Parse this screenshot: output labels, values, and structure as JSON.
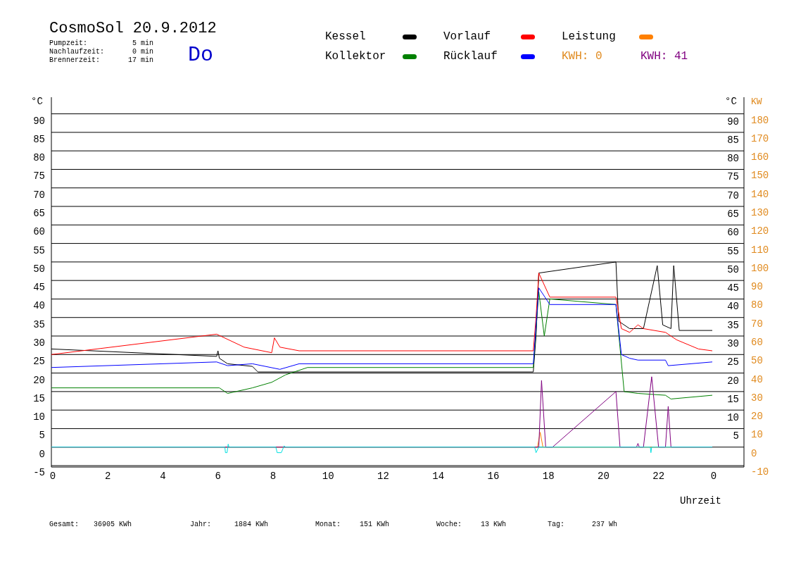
{
  "header": {
    "title": "CosmoSol 20.9.2012",
    "weekday": "Do",
    "times": [
      {
        "label": "Pumpzeit:",
        "value": "5 min"
      },
      {
        "label": "Nachlaufzeit:",
        "value": "0 min"
      },
      {
        "label": "Brennerzeit:",
        "value": "17 min"
      }
    ]
  },
  "totals": [
    {
      "label": "KWH: 0",
      "color": "#e08a1e"
    },
    {
      "label": "KWH: 41",
      "color": "#800080"
    }
  ],
  "chart_data": {
    "type": "line",
    "xlabel": "Uhrzeit",
    "ylabel": "°C",
    "y2label": "KW",
    "grid": true,
    "xlim": [
      0,
      25.15
    ],
    "ylim": [
      -5,
      90
    ],
    "y2lim": [
      -10,
      180
    ],
    "xticks": [
      0,
      2,
      4,
      6,
      8,
      10,
      12,
      14,
      16,
      18,
      20,
      22
    ],
    "yticks": [
      -5,
      0,
      5,
      10,
      15,
      20,
      25,
      30,
      35,
      40,
      45,
      50,
      55,
      60,
      65,
      70,
      75,
      80,
      85,
      90
    ],
    "y2ticks": [
      -10,
      0,
      10,
      20,
      30,
      40,
      50,
      60,
      70,
      80,
      90,
      100,
      110,
      120,
      130,
      140,
      150,
      160,
      170,
      180
    ],
    "series": [
      {
        "name": "Kessel",
        "color": "#000000",
        "x": [
          0,
          6,
          6.05,
          6.1,
          6.4,
          7.3,
          7.5,
          17.5,
          17.6,
          17.7,
          20.5,
          20.6,
          21.0,
          21.5,
          22.0,
          22.2,
          22.5,
          22.6,
          22.8,
          24
        ],
        "values": [
          26.5,
          24.5,
          26,
          24,
          22.5,
          21.8,
          20.3,
          20.3,
          30,
          47,
          50,
          34,
          32,
          32,
          49,
          33,
          32,
          49,
          31.5,
          31.5
        ]
      },
      {
        "name": "Vorlauf",
        "color": "#ff0000",
        "x": [
          0,
          6,
          7.0,
          8.0,
          8.1,
          8.3,
          9.0,
          17.5,
          17.6,
          17.7,
          18.1,
          20.5,
          20.7,
          21.0,
          21.3,
          21.5,
          22.3,
          22.7,
          23.5,
          24
        ],
        "values": [
          25,
          30.5,
          27,
          25.5,
          29.5,
          27,
          26,
          26,
          35,
          47,
          40.5,
          40.5,
          32,
          31,
          33,
          32,
          31,
          29,
          26.5,
          26
        ]
      },
      {
        "name": "Leistung",
        "color": "#ff8000",
        "axis": "y2",
        "x": [
          0,
          17.65,
          17.75,
          17.85,
          24
        ],
        "values": [
          0,
          0,
          8,
          0,
          0
        ]
      },
      {
        "name": "Kollektor",
        "color": "#008000",
        "x": [
          0,
          6.1,
          6.4,
          7.3,
          8.0,
          8.5,
          9.3,
          17.5,
          17.7,
          17.9,
          18.1,
          20.5,
          20.8,
          21.3,
          22.3,
          22.5,
          24
        ],
        "values": [
          16,
          16,
          14.5,
          16,
          17.5,
          19.5,
          21.5,
          21.5,
          42,
          30,
          40,
          38.5,
          15,
          14.5,
          14,
          13,
          14
        ]
      },
      {
        "name": "Rücklauf",
        "color": "#0000ff",
        "x": [
          0,
          6,
          6.4,
          7.3,
          8.3,
          9.0,
          17.5,
          17.7,
          18.1,
          20.5,
          20.7,
          21.0,
          21.3,
          22.3,
          22.4,
          24
        ],
        "values": [
          21.5,
          23,
          22,
          22.5,
          21,
          22.5,
          22.5,
          43,
          38.5,
          38.5,
          25,
          24,
          23.5,
          23.5,
          22,
          23
        ]
      },
      {
        "color": "#800080",
        "axis": "y2",
        "x": [
          0,
          17.7,
          17.8,
          17.95,
          18.2,
          20.5,
          20.65,
          21.25,
          21.3,
          21.35,
          21.5,
          21.8,
          22.05,
          22.3,
          22.4,
          22.5,
          24
        ],
        "values": [
          0,
          0,
          36,
          0,
          0,
          30,
          0,
          0,
          2,
          0,
          0,
          38,
          0,
          0,
          22,
          0,
          0
        ]
      },
      {
        "color": "#00e0e0",
        "x": [
          0,
          6.3,
          6.32,
          6.38,
          6.42,
          6.45,
          8.15,
          8.2,
          8.35,
          8.45,
          8.5,
          17.55,
          17.6,
          17.7,
          21.75,
          21.77,
          21.8,
          24
        ],
        "values": [
          0,
          0,
          -1.5,
          -1.5,
          0.8,
          0,
          0,
          -1.5,
          -1.5,
          0.3,
          0,
          0,
          -1.5,
          0,
          0,
          -1.5,
          0,
          0
        ]
      }
    ]
  },
  "right_scale": {
    "unit": "°C",
    "ticks": [
      "90",
      "85",
      "80",
      "75",
      "70",
      "65",
      "60",
      "55",
      "50",
      "45",
      "40",
      "35",
      "30",
      "25",
      "20",
      "15",
      "10",
      "5"
    ]
  },
  "x_axis_end_label": "0",
  "footer": [
    {
      "label": "Gesamt:",
      "value": "36905 KWh"
    },
    {
      "label": "Jahr:",
      "value": "1884 KWh"
    },
    {
      "label": "Monat:",
      "value": "151 KWh"
    },
    {
      "label": "Woche:",
      "value": "13 KWh"
    },
    {
      "label": "Tag:",
      "value": "237 Wh"
    }
  ]
}
